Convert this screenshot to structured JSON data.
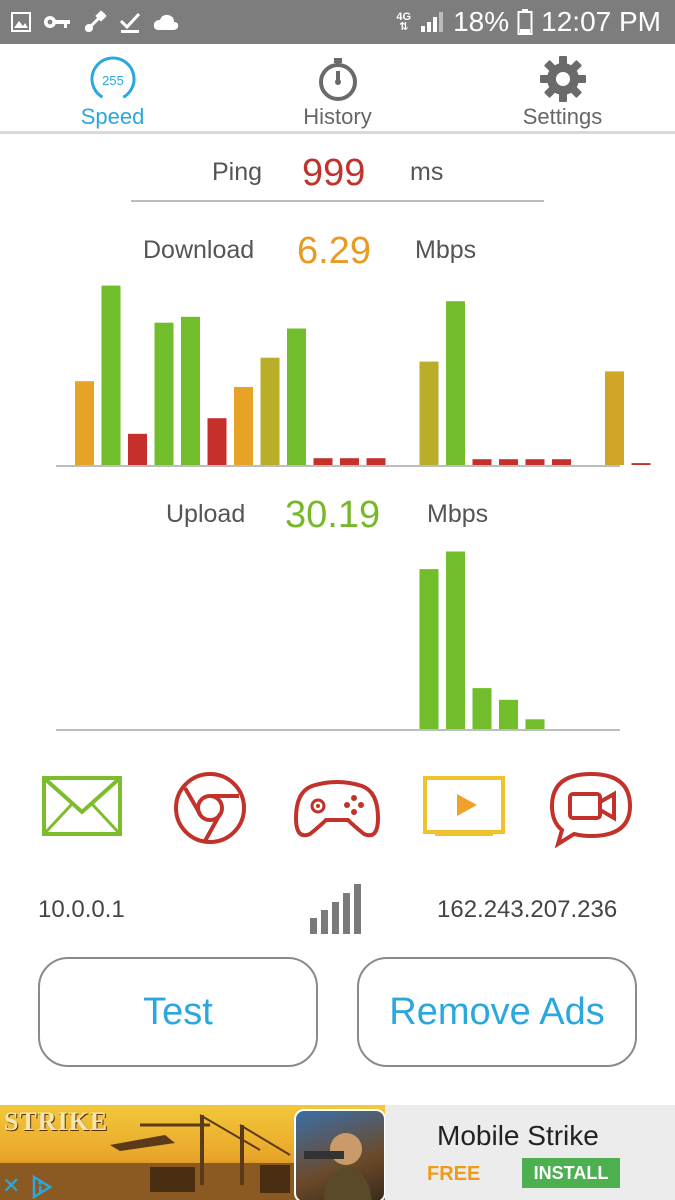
{
  "status_bar": {
    "network_top": "4G",
    "network_bottom": "⇅",
    "battery": "18%",
    "time": "12:07 PM",
    "left_icons": [
      "image-icon",
      "key-icon",
      "usb-icon",
      "check-icon",
      "cloud-icon"
    ]
  },
  "tabs": [
    {
      "label": "Speed",
      "icon": "speedometer-icon",
      "active": true,
      "badge": "255"
    },
    {
      "label": "History",
      "icon": "stopwatch-icon",
      "active": false
    },
    {
      "label": "Settings",
      "icon": "gear-icon",
      "active": false
    }
  ],
  "ping": {
    "label": "Ping",
    "value": "999",
    "unit": "ms",
    "color": "#c0322b"
  },
  "download": {
    "label": "Download",
    "value": "6.29",
    "unit": "Mbps",
    "color": "#e99a21"
  },
  "upload": {
    "label": "Upload",
    "value": "30.19",
    "unit": "Mbps",
    "color": "#76b82a"
  },
  "chart_data": [
    {
      "type": "bar",
      "title": "Download",
      "values": [
        43,
        92,
        16,
        73,
        76,
        24,
        40,
        55,
        70,
        3.5,
        3.5,
        3.5,
        0,
        53,
        84,
        3,
        3,
        3,
        3,
        0,
        48,
        1
      ],
      "colors": [
        "#e7a326",
        "#72bd2b",
        "#c6302a",
        "#72bd2b",
        "#72bd2b",
        "#c6302a",
        "#e7a326",
        "#b9ad2a",
        "#72bd2b",
        "#c6302a",
        "#c6302a",
        "#c6302a",
        "#ffffff",
        "#b9ad2a",
        "#72bd2b",
        "#c6302a",
        "#c6302a",
        "#c6302a",
        "#c6302a",
        "#ffffff",
        "#cfa628",
        "#c6302a"
      ],
      "ylim": [
        0,
        100
      ]
    },
    {
      "type": "bar",
      "title": "Upload",
      "values": [
        0,
        0,
        0,
        0,
        0,
        0,
        0,
        0,
        0,
        0,
        0,
        0,
        0,
        82,
        91,
        21,
        15,
        5,
        0,
        0,
        0,
        0
      ],
      "colors": [
        "#ffffff",
        "#ffffff",
        "#ffffff",
        "#ffffff",
        "#ffffff",
        "#ffffff",
        "#ffffff",
        "#ffffff",
        "#ffffff",
        "#ffffff",
        "#ffffff",
        "#ffffff",
        "#ffffff",
        "#72bd2b",
        "#72bd2b",
        "#72bd2b",
        "#72bd2b",
        "#72bd2b",
        "#ffffff",
        "#ffffff",
        "#ffffff",
        "#ffffff"
      ],
      "ylim": [
        0,
        100
      ]
    }
  ],
  "services": [
    {
      "name": "mail-icon",
      "color": "#7cbc2d"
    },
    {
      "name": "chrome-icon",
      "color": "#c2322a"
    },
    {
      "name": "gamepad-icon",
      "color": "#c2322a"
    },
    {
      "name": "video-play-icon",
      "color": "#f0c22d"
    },
    {
      "name": "video-chat-icon",
      "color": "#c2322a"
    }
  ],
  "local_ip": "10.0.0.1",
  "remote_ip": "162.243.207.236",
  "buttons": {
    "test": "Test",
    "remove_ads": "Remove Ads"
  },
  "ad": {
    "game_logo": "STRIKE",
    "title": "Mobile Strike",
    "free": "FREE",
    "install": "INSTALL"
  }
}
